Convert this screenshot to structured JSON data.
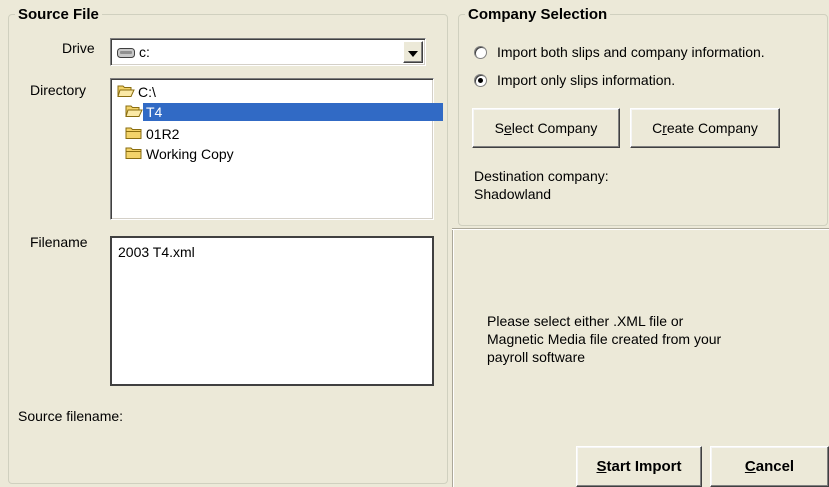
{
  "source_file": {
    "group_title": "Source File",
    "drive_label": "Drive",
    "drive_value": "c:",
    "drive_icon": "hard-drive-icon",
    "directory_label": "Directory",
    "directories": [
      {
        "label": "C:\\",
        "icon": "open-folder-icon",
        "selected": false
      },
      {
        "label": "T4",
        "icon": "open-folder-icon",
        "selected": true
      },
      {
        "label": "01R2",
        "icon": "folder-icon",
        "selected": false
      },
      {
        "label": "Working Copy",
        "icon": "folder-icon",
        "selected": false
      }
    ],
    "filename_label": "Filename",
    "files": [
      "2003 T4.xml"
    ],
    "source_filename_label": "Source filename:"
  },
  "company_selection": {
    "group_title": "Company Selection",
    "options": [
      {
        "label": "Import both slips and company information.",
        "checked": false
      },
      {
        "label": "Import only slips  information.",
        "checked": true
      }
    ],
    "select_company_pre": "S",
    "select_company_key": "e",
    "select_company_post": "lect Company",
    "create_company_pre": "C",
    "create_company_key": "r",
    "create_company_post": "eate Company",
    "destination_label": "Destination company:",
    "destination_value": "Shadowland"
  },
  "instructions": {
    "line1": "Please select either .XML file or",
    "line2": "Magnetic Media file created from your",
    "line3": "payroll software"
  },
  "actions": {
    "start_key": "S",
    "start_rest": "tart Import",
    "cancel_key": "C",
    "cancel_rest": "ancel"
  },
  "colors": {
    "background": "#ece9d8",
    "selection": "#316ac5",
    "folder": "#f3d36a"
  }
}
